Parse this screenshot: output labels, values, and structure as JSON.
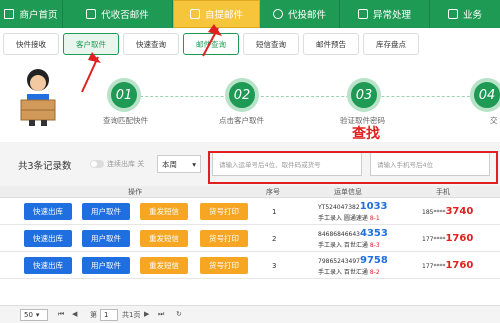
{
  "nav": [
    {
      "label": "商户首页",
      "icon": "home-icon"
    },
    {
      "label": "代收否邮件",
      "icon": "grid-icon"
    },
    {
      "label": "自提邮件",
      "icon": "box-icon"
    },
    {
      "label": "代投邮件",
      "icon": "refresh-icon"
    },
    {
      "label": "异常处理",
      "icon": "alert-icon"
    },
    {
      "label": "业务",
      "icon": "stats-icon"
    }
  ],
  "subnav": [
    "快件接收",
    "客户取件",
    "快速查询",
    "邮件查询",
    "短信查询",
    "邮件预告",
    "库存盘点"
  ],
  "steps": [
    {
      "num": "01",
      "label": "查询匹配快件"
    },
    {
      "num": "02",
      "label": "点击客户取件"
    },
    {
      "num": "03",
      "label": "验证取件密码"
    },
    {
      "num": "04",
      "label": "交"
    }
  ],
  "toolbar": {
    "records": "共3条记录数",
    "toggle": "连续出库 关",
    "period": "本周",
    "search_placeholder": "请输入运单号后4位、取件码或货号",
    "phone_placeholder": "请输入手机号后4位",
    "find_label": "查找"
  },
  "table": {
    "headers": {
      "actions": "操作",
      "seq": "序号",
      "tracking": "运单信息",
      "phone": "手机"
    },
    "buttons": {
      "out": "快速出库",
      "pick": "用户取件",
      "sms": "重发短信",
      "print": "货号打印"
    },
    "rows": [
      {
        "seq": "1",
        "track_pre": "YT524047382",
        "track_bold": "1033",
        "desc": "手工录入 圆通速递",
        "code": "8-1",
        "phone_pre": "185****",
        "phone_bold": "3740"
      },
      {
        "seq": "2",
        "track_pre": "84686846643",
        "track_bold": "4353",
        "desc": "手工录入 百世汇通",
        "code": "8-3",
        "phone_pre": "177****",
        "phone_bold": "1760"
      },
      {
        "seq": "3",
        "track_pre": "79865243497",
        "track_bold": "9758",
        "desc": "手工录入 百世汇通",
        "code": "8-2",
        "phone_pre": "177****",
        "phone_bold": "1760"
      }
    ]
  },
  "pager": {
    "size": "50",
    "page_label": "第",
    "page": "1",
    "total": "共1页"
  }
}
